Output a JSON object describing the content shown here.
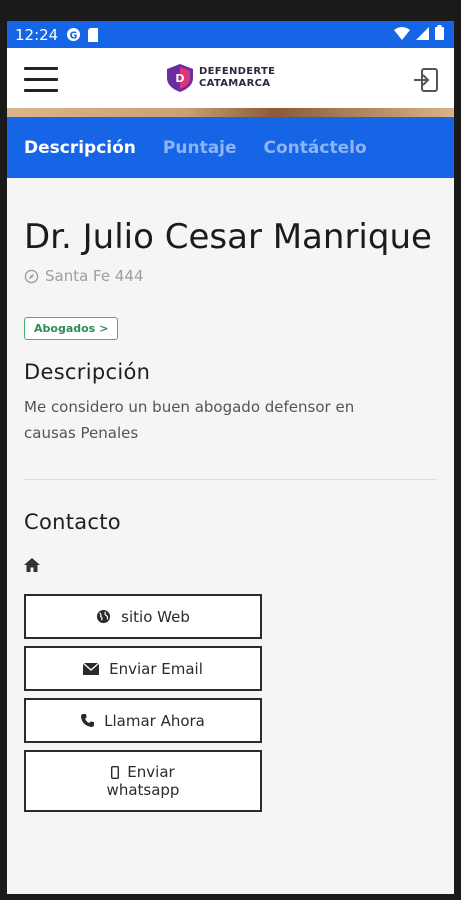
{
  "status_bar": {
    "time": "12:24",
    "icons": [
      "app-notification-icon",
      "sd-card-icon",
      "wifi-icon",
      "signal-icon",
      "battery-icon"
    ]
  },
  "app_bar": {
    "logo_line1": "DEFENDERTE",
    "logo_line2": "CATAMARCA",
    "menu_icon": "hamburger-menu-icon",
    "login_icon": "login-icon"
  },
  "tabs": [
    {
      "label": "Descripción",
      "active": true
    },
    {
      "label": "Puntaje",
      "active": false
    },
    {
      "label": "Contáctelo",
      "active": false
    }
  ],
  "profile": {
    "name": "Dr. Julio Cesar Manrique",
    "address": "Santa Fe 444",
    "category": "Abogados",
    "category_chevron": ">"
  },
  "description": {
    "title": "Descripción",
    "text": "Me considero un buen abogado defensor en causas Penales"
  },
  "contact": {
    "title": "Contacto",
    "buttons": {
      "website": "sitio Web",
      "email": "Enviar Email",
      "call": "Llamar Ahora",
      "whatsapp_line1": "Enviar",
      "whatsapp_line2": "whatsapp"
    }
  },
  "colors": {
    "primary": "#1565e6",
    "tab_inactive": "#8fb4f6",
    "chip": "#2e8b57"
  }
}
